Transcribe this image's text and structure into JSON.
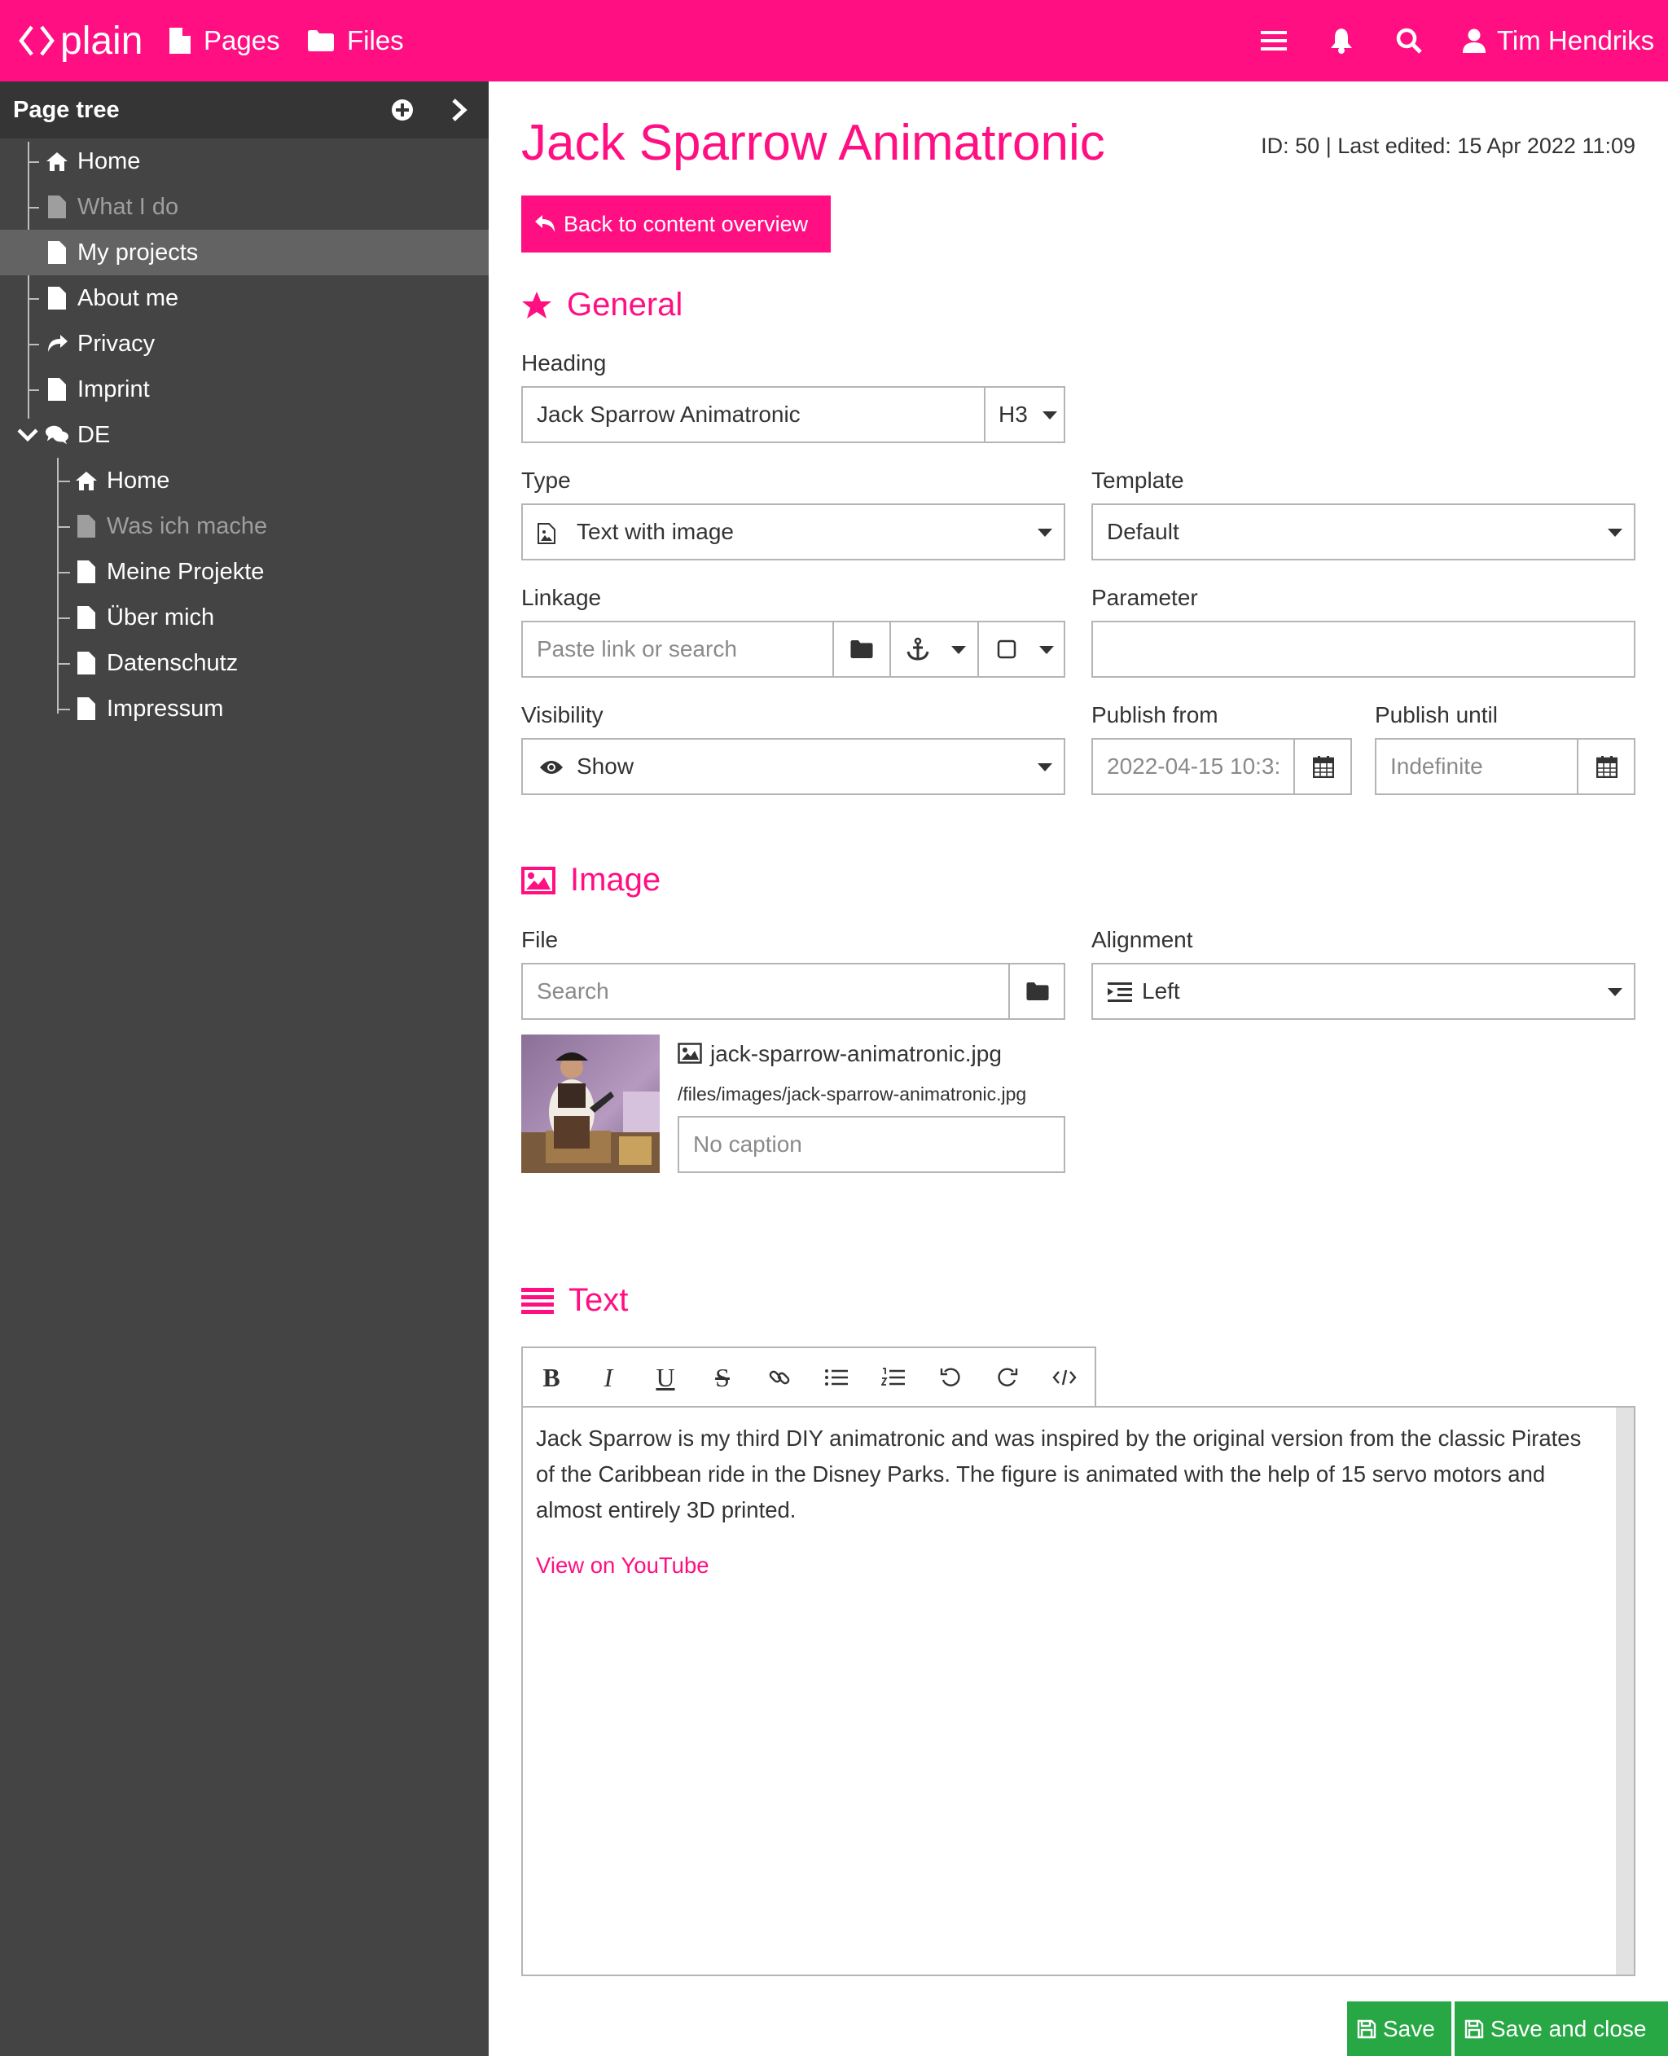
{
  "topbar": {
    "logo_text": "plain",
    "nav_pages": "Pages",
    "nav_files": "Files",
    "user_name": "Tim Hendriks"
  },
  "sidebar": {
    "title": "Page tree",
    "items": [
      {
        "label": "Home",
        "icon": "home-icon"
      },
      {
        "label": "What I do",
        "icon": "file-icon"
      },
      {
        "label": "My projects",
        "icon": "file-icon"
      },
      {
        "label": "About me",
        "icon": "file-icon"
      },
      {
        "label": "Privacy",
        "icon": "redirect-icon"
      },
      {
        "label": "Imprint",
        "icon": "file-icon"
      },
      {
        "label": "DE",
        "icon": "language-icon"
      },
      {
        "label": "Home",
        "icon": "home-icon"
      },
      {
        "label": "Was ich mache",
        "icon": "file-icon"
      },
      {
        "label": "Meine Projekte",
        "icon": "file-icon"
      },
      {
        "label": "Über mich",
        "icon": "file-icon"
      },
      {
        "label": "Datenschutz",
        "icon": "file-icon"
      },
      {
        "label": "Impressum",
        "icon": "file-icon"
      }
    ]
  },
  "page": {
    "title": "Jack Sparrow Animatronic",
    "meta": "ID: 50 | Last edited: 15 Apr 2022 11:09",
    "back_label": "Back to content overview"
  },
  "general": {
    "section_title": "General",
    "heading_label": "Heading",
    "heading_value": "Jack Sparrow Animatronic",
    "heading_level": "H3",
    "type_label": "Type",
    "type_value": "Text with image",
    "template_label": "Template",
    "template_value": "Default",
    "linkage_label": "Linkage",
    "linkage_placeholder": "Paste link or search",
    "parameter_label": "Parameter",
    "parameter_value": "",
    "visibility_label": "Visibility",
    "visibility_value": "Show",
    "publish_from_label": "Publish from",
    "publish_from_value": "2022-04-15 10:3:",
    "publish_until_label": "Publish until",
    "publish_until_placeholder": "Indefinite"
  },
  "image": {
    "section_title": "Image",
    "file_label": "File",
    "file_placeholder": "Search",
    "alignment_label": "Alignment",
    "alignment_value": "Left",
    "filename": "jack-sparrow-animatronic.jpg",
    "filepath": "/files/images/jack-sparrow-animatronic.jpg",
    "caption_placeholder": "No caption"
  },
  "text": {
    "section_title": "Text",
    "toolbar": {
      "bold": "B",
      "italic": "I",
      "underline": "U",
      "strike": "S"
    },
    "body": "Jack Sparrow is my third DIY animatronic and was inspired by the original version from the classic Pirates of the Caribbean ride in the Disney Parks. The figure is animated with the help of 15 servo motors and almost entirely 3D printed.",
    "link": "View on YouTube"
  },
  "actions": {
    "save": "Save",
    "save_close": "Save and close"
  },
  "colors": {
    "accent": "#ff0f82",
    "sidebar_bg": "#444444",
    "save_green": "#28a745"
  }
}
